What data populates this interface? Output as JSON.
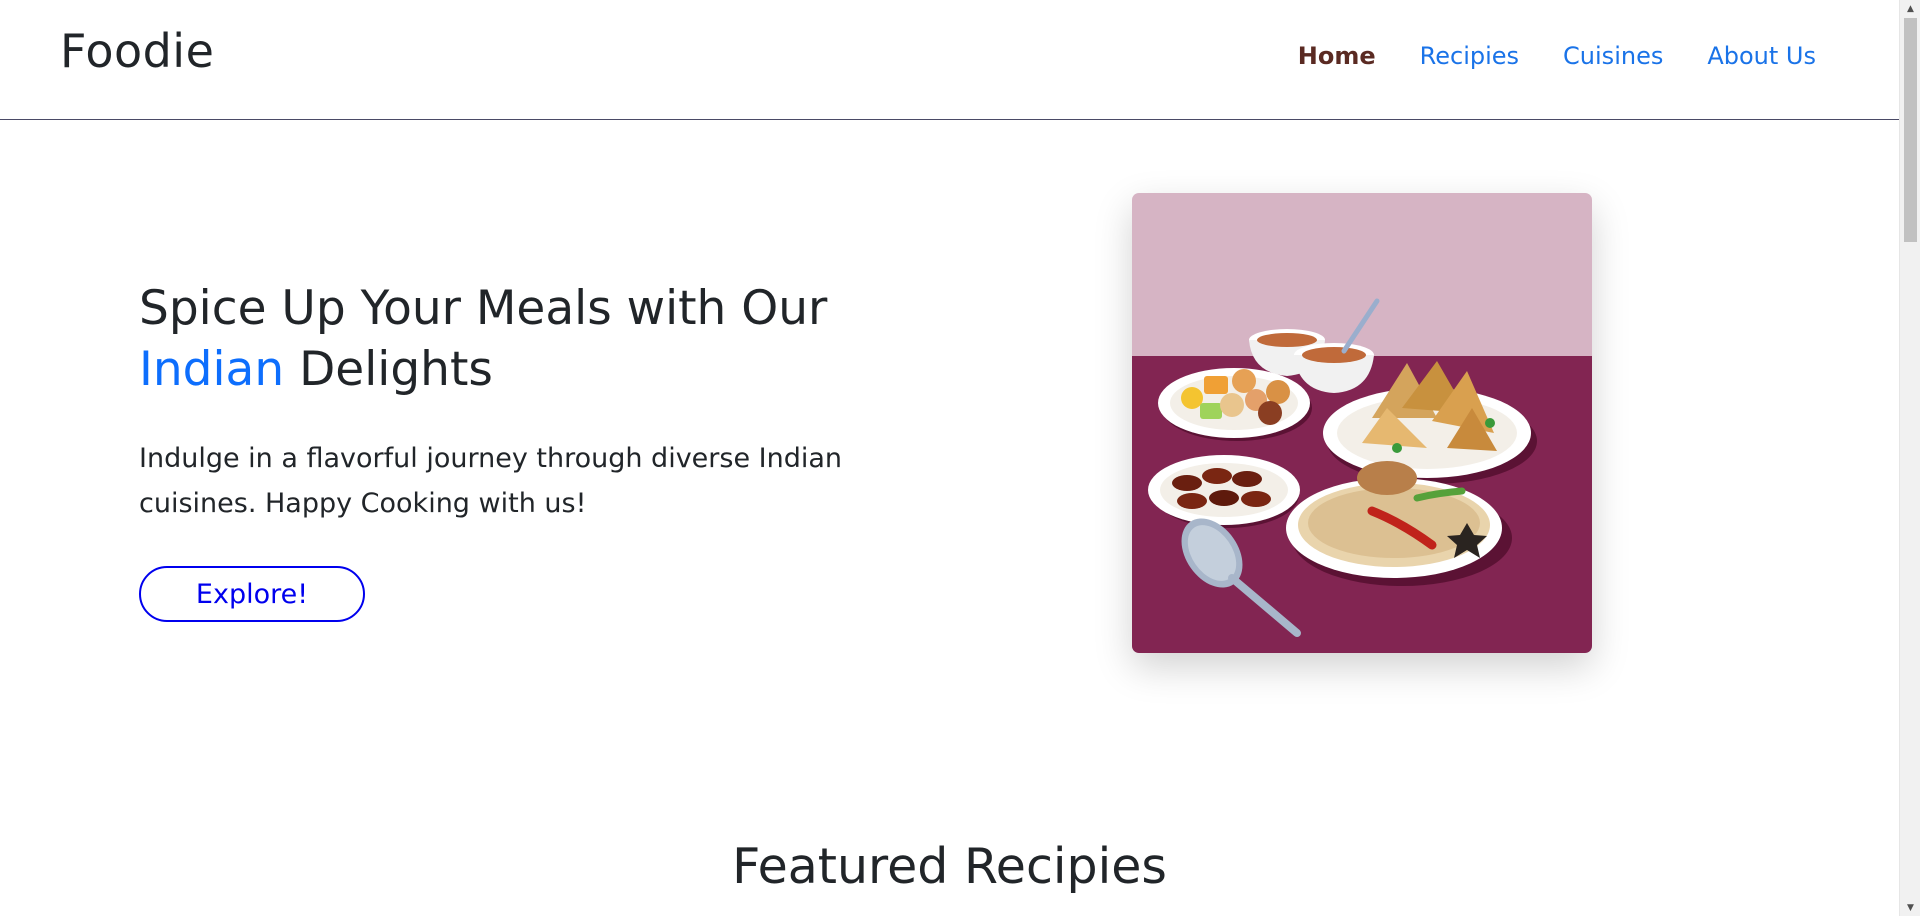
{
  "header": {
    "brand": "Foodie",
    "nav": [
      {
        "label": "Home",
        "active": true
      },
      {
        "label": "Recipies",
        "active": false
      },
      {
        "label": "Cuisines",
        "active": false
      },
      {
        "label": "About Us",
        "active": false
      }
    ]
  },
  "hero": {
    "title_part1": "Spice Up Your Meals with Our",
    "title_accent": "Indian",
    "title_part2": "Delights",
    "description": "Indulge in a flavorful journey through diverse Indian cuisines. Happy Cooking with us!",
    "button_label": "Explore!",
    "image_icon": "indian-food-platter-illustration"
  },
  "featured": {
    "title": "Featured Recipies"
  },
  "colors": {
    "accent": "#0d6efd",
    "nav_link": "#1a73e8",
    "nav_active": "#5a2a22",
    "button_border": "#0000ee",
    "image_bg_top": "#d6b4c4",
    "image_bg_bottom": "#822552"
  }
}
